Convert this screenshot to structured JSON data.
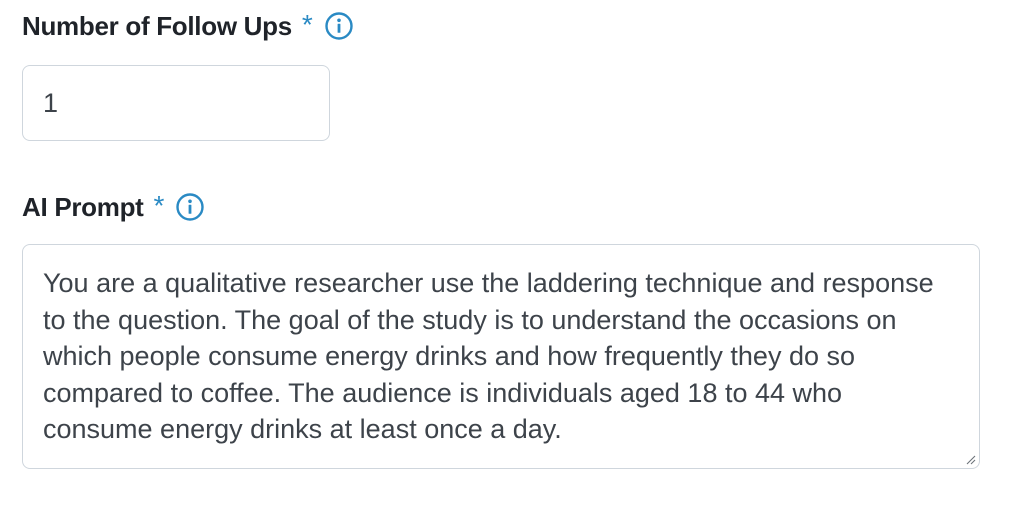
{
  "fields": {
    "follow_ups": {
      "label": "Number of Follow Ups",
      "required_marker": "*",
      "value": "1"
    },
    "ai_prompt": {
      "label": "AI Prompt",
      "required_marker": "*",
      "value": "You are a qualitative researcher use the laddering technique and response to the question. The goal of the study is to understand the occasions on which people consume energy drinks and how frequently they do so compared to coffee. The audience is individuals aged 18 to 44 who consume energy drinks at least once a day."
    }
  },
  "icons": {
    "info": "info-icon",
    "resize": "resize-grip-icon"
  },
  "colors": {
    "accent": "#2a8ac4",
    "label_text": "#1f2329",
    "input_text": "#3d434a",
    "border": "#cfd6dd"
  }
}
